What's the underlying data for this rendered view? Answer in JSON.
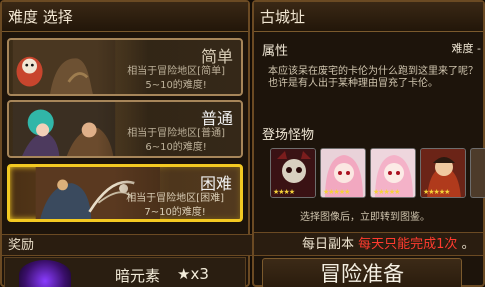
{
  "left": {
    "title": "难度 选择",
    "difficulties": [
      {
        "label": "简单",
        "desc1": "相当于冒险地区[简单]",
        "desc2": "5~10的难度!"
      },
      {
        "label": "普通",
        "desc1": "相当于冒险地区[普通]",
        "desc2": "6~10的难度!"
      },
      {
        "label": "困难",
        "desc1": "相当于冒险地区[困难]",
        "desc2": "7~10的难度!"
      }
    ],
    "reward_header": "奖励",
    "reward_item": {
      "name": "暗元素",
      "count": "★x3",
      "icon": "dark-element-icon"
    }
  },
  "right": {
    "title": "古城址",
    "attribute_label": "属性",
    "difficulty_label": "难度 -",
    "description": "本应该呆在废宅的卡伦为什么跑到这里来了呢？也许是有人出于某种理由冒充了卡伦。",
    "monster_section_label": "登场怪物",
    "monsters": [
      {
        "stars": "★★★★",
        "icon": "skull-warrior-icon"
      },
      {
        "stars": "★★★★★",
        "icon": "pink-hair-girl-icon"
      },
      {
        "stars": "★★★★★",
        "icon": "pink-hair-girl-icon"
      },
      {
        "stars": "★★★★★",
        "icon": "red-robe-warrior-icon"
      }
    ],
    "monster_hint": "选择图像后，立即转到图鉴。",
    "daily_prefix": "每日副本",
    "daily_highlight": "每天只能完成1次",
    "daily_suffix": "。",
    "prepare_button": "冒险准备"
  }
}
